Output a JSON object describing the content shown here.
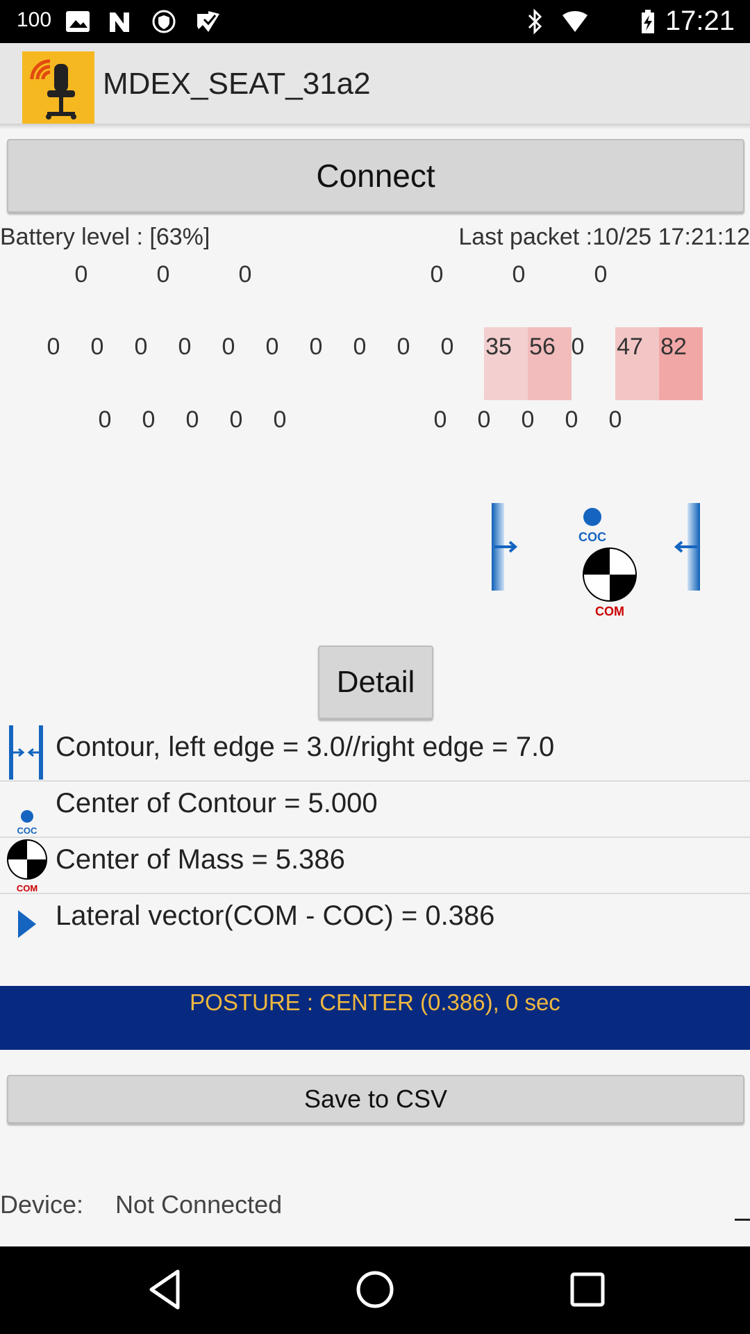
{
  "status_bar": {
    "battery_percent": "100",
    "time": "17:21",
    "icons": [
      "image-icon",
      "n-icon",
      "vpn-shield-icon",
      "download-check-icon",
      "bluetooth-icon",
      "wifi-icon",
      "battery-icon"
    ]
  },
  "app": {
    "title": "MDEX_SEAT_31a2",
    "logo_icon": "chair-wifi-icon"
  },
  "connect_label": "Connect",
  "battery_level": "Battery level : [63%]",
  "last_packet": "Last packet :10/25 17:21:12",
  "sensors": {
    "top_left": [
      "0",
      "0",
      "0"
    ],
    "top_right": [
      "0",
      "0",
      "0"
    ],
    "middle": [
      "0",
      "0",
      "0",
      "0",
      "0",
      "0",
      "0",
      "0",
      "0",
      "0",
      "35",
      "56",
      "0",
      "47",
      "82"
    ],
    "bottom_left": [
      "0",
      "0",
      "0",
      "0",
      "0"
    ],
    "bottom_right": [
      "0",
      "0",
      "0",
      "0",
      "0"
    ],
    "heat_levels": {
      "35": 0.35,
      "56": 0.56,
      "47": 0.47,
      "82": 0.82
    }
  },
  "diagram": {
    "coc_label": "COC",
    "com_label": "COM"
  },
  "detail_label": "Detail",
  "metrics": [
    {
      "icon": "contour-edges-icon",
      "text": "Contour, left edge = 3.0//right edge = 7.0"
    },
    {
      "icon": "coc-icon",
      "text": "Center of Contour = 5.000",
      "icon_label": "COC"
    },
    {
      "icon": "com-icon",
      "text": "Center of Mass = 5.386",
      "icon_label": "COM"
    },
    {
      "icon": "play-arrow-icon",
      "text": "Lateral vector(COM - COC) = 0.386"
    }
  ],
  "posture": "POSTURE : CENTER (0.386), 0 sec",
  "save_csv_label": "Save to CSV",
  "device": {
    "label": "Device:",
    "status": "Not Connected"
  },
  "colors": {
    "posture_bg": "#072a80",
    "posture_text": "#f0b840",
    "accent_blue": "#1565c0",
    "com_red": "#cc0000",
    "logo_bg": "#f6b820"
  }
}
